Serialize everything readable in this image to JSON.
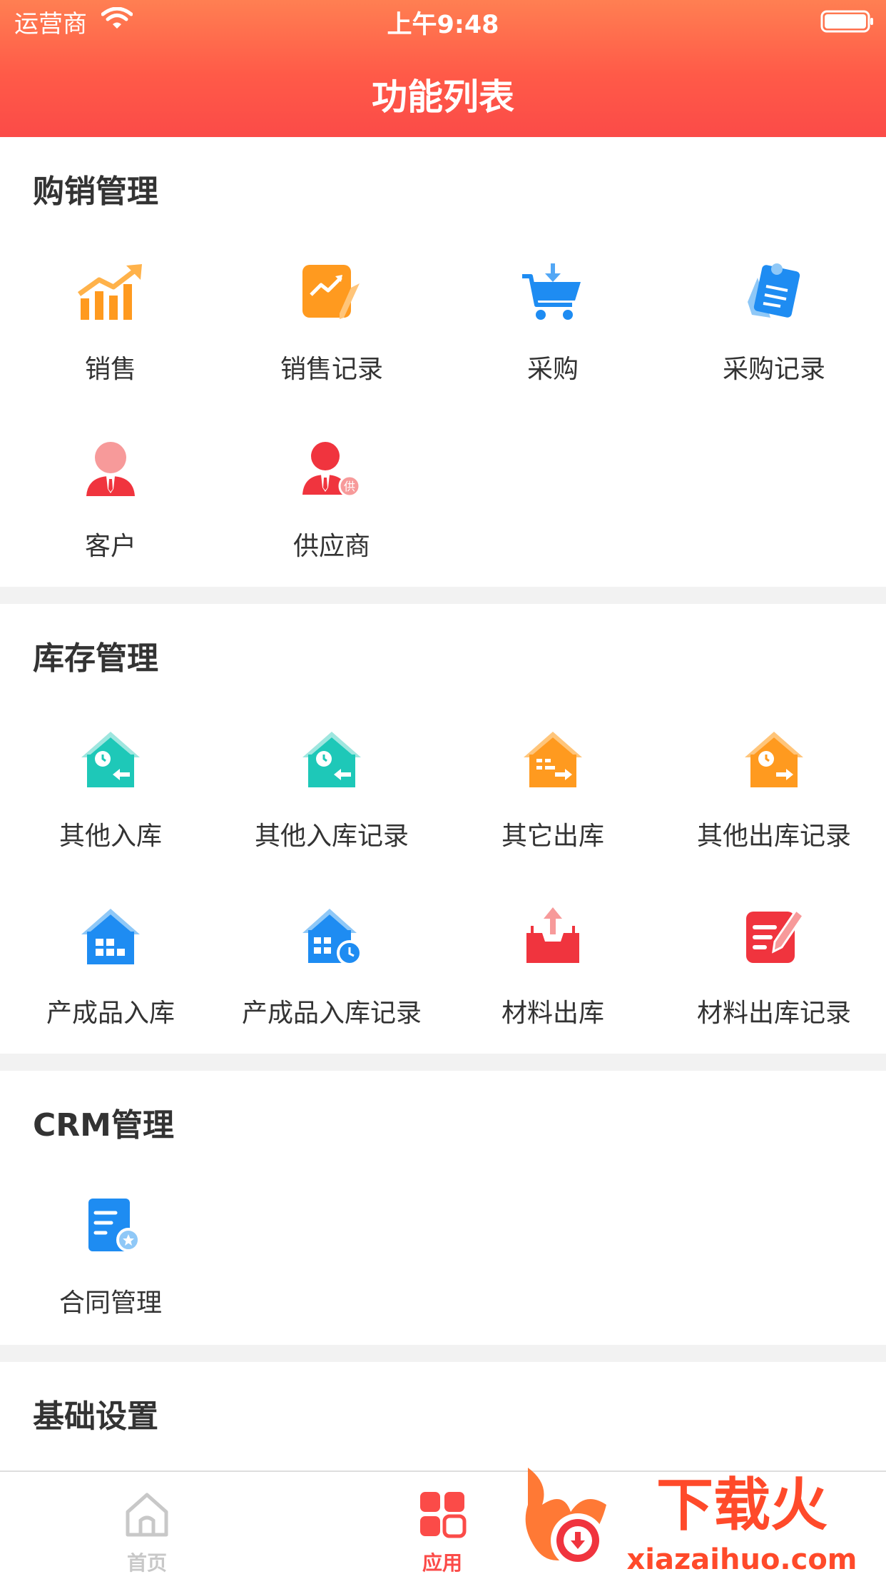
{
  "status_bar": {
    "carrier": "运营商",
    "time": "上午9:48"
  },
  "header": {
    "title": "功能列表"
  },
  "sections": [
    {
      "title": "购销管理",
      "items": [
        {
          "label": "销售",
          "icon": "sales-chart-icon"
        },
        {
          "label": "销售记录",
          "icon": "sales-record-icon"
        },
        {
          "label": "采购",
          "icon": "cart-icon"
        },
        {
          "label": "采购记录",
          "icon": "clipboard-icon"
        },
        {
          "label": "客户",
          "icon": "customer-icon"
        },
        {
          "label": "供应商",
          "icon": "supplier-icon"
        }
      ]
    },
    {
      "title": "库存管理",
      "items": [
        {
          "label": "其他入库",
          "icon": "warehouse-in-icon"
        },
        {
          "label": "其他入库记录",
          "icon": "warehouse-in-record-icon"
        },
        {
          "label": "其它出库",
          "icon": "warehouse-out-icon"
        },
        {
          "label": "其他出库记录",
          "icon": "warehouse-out-record-icon"
        },
        {
          "label": "产成品入库",
          "icon": "product-in-icon"
        },
        {
          "label": "产成品入库记录",
          "icon": "product-in-record-icon"
        },
        {
          "label": "材料出库",
          "icon": "material-out-icon"
        },
        {
          "label": "材料出库记录",
          "icon": "material-out-record-icon"
        }
      ]
    },
    {
      "title": "CRM管理",
      "items": [
        {
          "label": "合同管理",
          "icon": "contract-icon"
        }
      ]
    },
    {
      "title": "基础设置",
      "items": []
    }
  ],
  "supplier_badge": "供",
  "tabbar": {
    "tabs": [
      {
        "label": "首页",
        "icon": "home-icon",
        "active": false
      },
      {
        "label": "应用",
        "icon": "apps-icon",
        "active": true
      }
    ],
    "active_color": "#fb4b48",
    "inactive_color": "#c8c8c8"
  },
  "watermark": {
    "text": "下载火",
    "url_text": "xiazaihuo.com"
  },
  "colors": {
    "header_start": "#ff7f52",
    "header_end": "#fb4b48",
    "orange": "#ff9a1f",
    "blue": "#1e8cf2",
    "teal": "#1ec8b8",
    "red": "#f0343e"
  }
}
